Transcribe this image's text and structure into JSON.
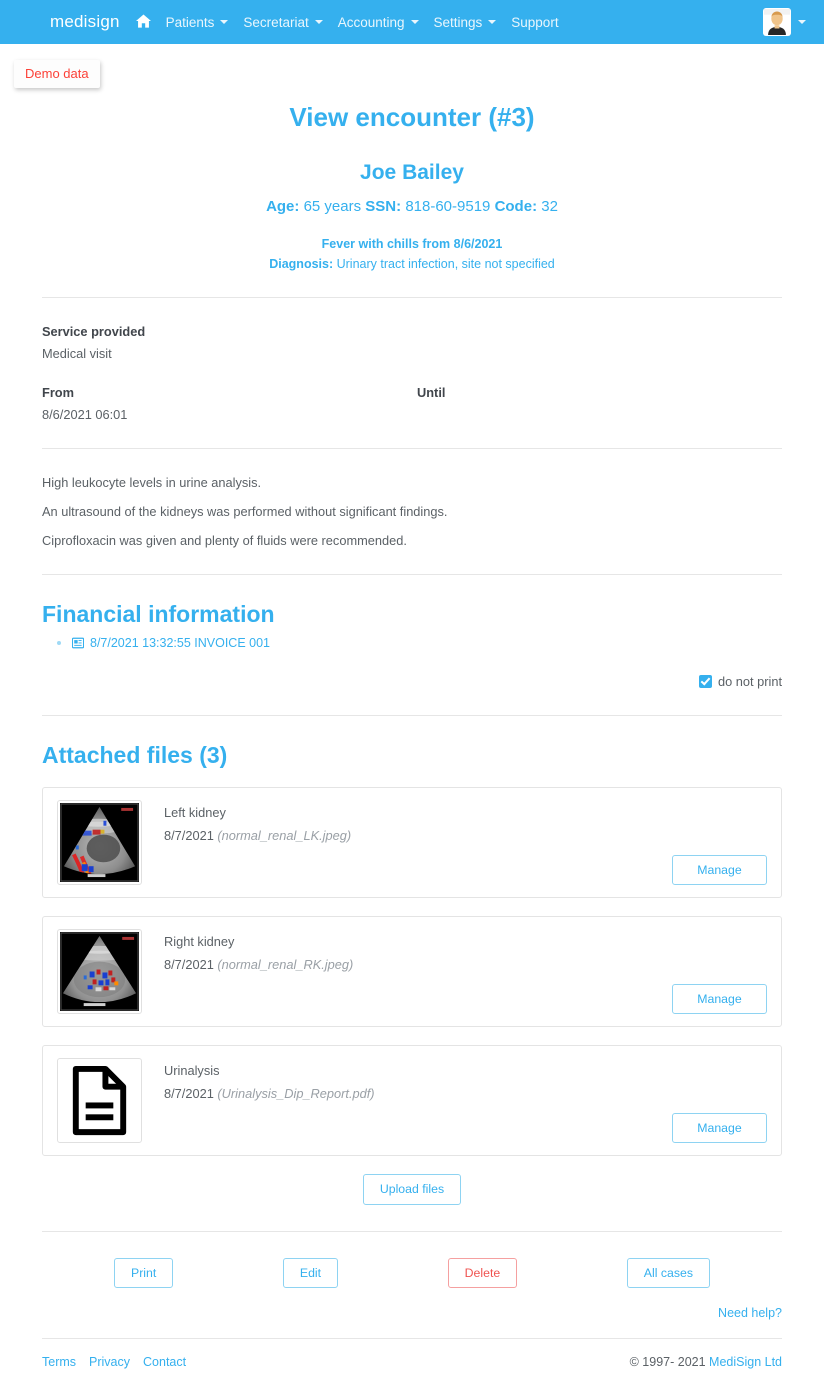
{
  "navbar": {
    "brand": "medisign",
    "home_icon": "home-icon",
    "items": [
      {
        "label": "Patients",
        "has_caret": true
      },
      {
        "label": "Secretariat",
        "has_caret": true
      },
      {
        "label": "Accounting",
        "has_caret": true
      },
      {
        "label": "Settings",
        "has_caret": true
      },
      {
        "label": "Support",
        "has_caret": false
      }
    ],
    "avatar_icon": "user-avatar",
    "avatar_caret": true,
    "bg_color": "#35b0ee"
  },
  "demo_badge": {
    "label": "Demo data",
    "color": "#fc4138"
  },
  "page": {
    "title": "View encounter (#3)",
    "accent_color": "#35b0ee"
  },
  "patient": {
    "name": "Joe Bailey",
    "age_label": "Age:",
    "age_value": "65 years",
    "ssn_label": "SSN:",
    "ssn_value": "818-60-9519",
    "code_label": "Code:",
    "code_value": "32",
    "reason": "Fever with chills from 8/6/2021",
    "diagnosis_label": "Diagnosis:",
    "diagnosis_value": "Urinary tract infection, site not specified"
  },
  "service": {
    "label": "Service provided",
    "value": "Medical visit",
    "from_label": "From",
    "from_value": "8/6/2021 06:01",
    "until_label": "Until",
    "until_value": ""
  },
  "notes": [
    "High leukocyte levels in urine analysis.",
    "An ultrasound of the kidneys was performed without significant findings.",
    "Ciprofloxacin was given and plenty of fluids were recommended."
  ],
  "financial": {
    "title": "Financial information",
    "entries": [
      {
        "icon": "invoice-icon",
        "label": "8/7/2021 13:32:55 INVOICE 001"
      }
    ],
    "do_not_print_label": "do not print",
    "do_not_print_checked": true
  },
  "attached": {
    "title": "Attached files (3)",
    "count": 3,
    "files": [
      {
        "thumb": "ultrasound-left-kidney-thumbnail",
        "title": "Left kidney",
        "date": "8/7/2021",
        "filename": "(normal_renal_LK.jpeg)",
        "manage_label": "Manage"
      },
      {
        "thumb": "ultrasound-right-kidney-thumbnail",
        "title": "Right kidney",
        "date": "8/7/2021",
        "filename": "(normal_renal_RK.jpeg)",
        "manage_label": "Manage"
      },
      {
        "thumb": "pdf-document-icon",
        "title": "Urinalysis",
        "date": "8/7/2021",
        "filename": "(Urinalysis_Dip_Report.pdf)",
        "manage_label": "Manage"
      }
    ],
    "upload_label": "Upload files"
  },
  "actions": {
    "print": "Print",
    "edit": "Edit",
    "delete": "Delete",
    "all_cases": "All cases",
    "need_help": "Need help?"
  },
  "footer": {
    "links": [
      "Terms",
      "Privacy",
      "Contact"
    ],
    "copyright": "© 1997- 2021 ",
    "company": "MediSign Ltd"
  }
}
